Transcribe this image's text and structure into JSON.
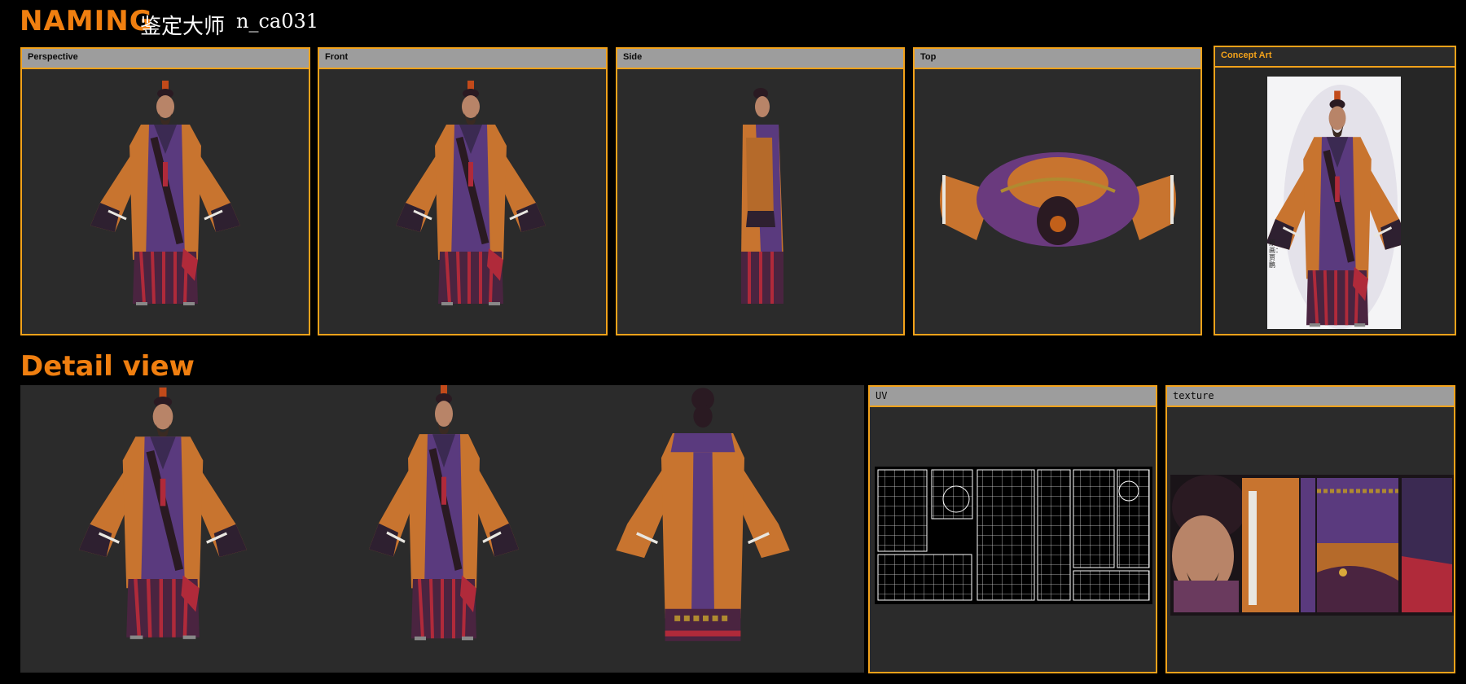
{
  "header": {
    "brand": "NAMING",
    "chinese_name": "鉴定大师",
    "asset_code": "n_ca031"
  },
  "views": [
    {
      "label": "Perspective"
    },
    {
      "label": "Front"
    },
    {
      "label": "Side"
    },
    {
      "label": "Top"
    },
    {
      "label": "Concept Art"
    }
  ],
  "detail": {
    "title": "Detail view",
    "uv_label": "UV",
    "texture_label": "texture"
  },
  "concept_signature": "原画：贾鹏",
  "colors": {
    "accent_orange": "#f07f10",
    "panel_border": "#f3a21a",
    "panel_bg": "#2b2b2b",
    "panel_header": "#9d9d9d",
    "robe_orange": "#c8742f",
    "robe_purple": "#5a3a7e",
    "robe_red": "#b02a3a"
  }
}
